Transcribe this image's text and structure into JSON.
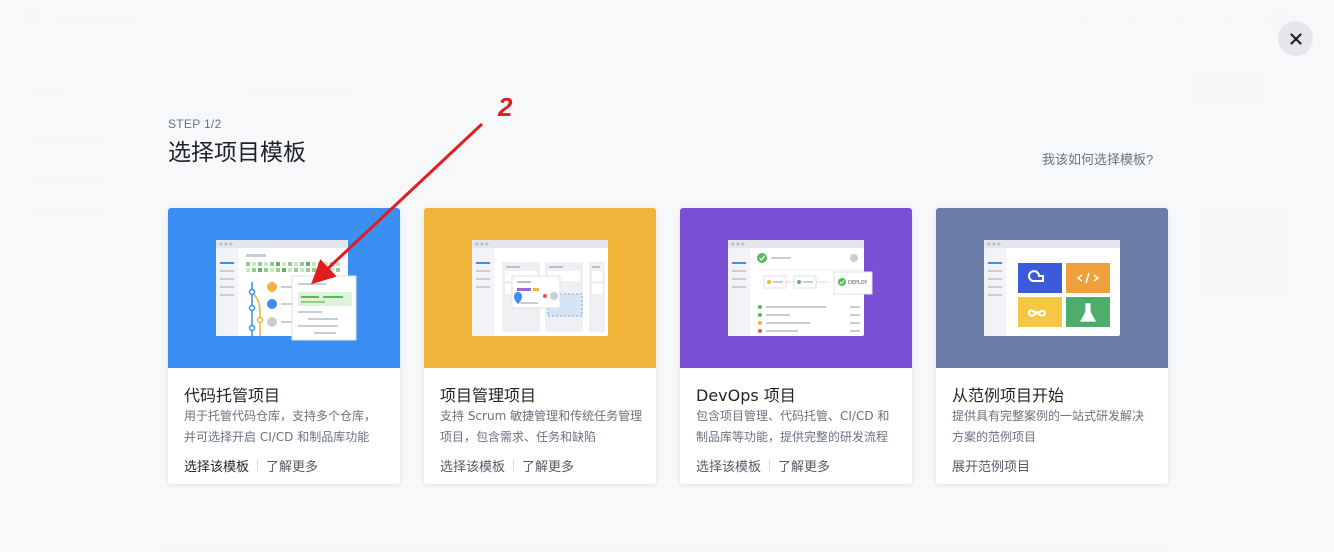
{
  "modal": {
    "step": "STEP 1/2",
    "title": "选择项目模板",
    "help_link": "我该如何选择模板?"
  },
  "cards": [
    {
      "name": "代码托管项目",
      "desc_line1": "用于托管代码仓库，支持多个仓库，",
      "desc_line2": "并可选择开启 CI/CD 和制品库功能",
      "action_primary": "选择该模板",
      "action_secondary": "了解更多",
      "hero_color": "#3b8ef2"
    },
    {
      "name": "项目管理项目",
      "desc_line1": "支持 Scrum 敏捷管理和传统任务管理",
      "desc_line2": "项目，包含需求、任务和缺陷",
      "action_primary": "选择该模板",
      "action_secondary": "了解更多",
      "hero_color": "#f0b43a"
    },
    {
      "name": "DevOps 项目",
      "desc_line1": "包含项目管理、代码托管、CI/CD 和",
      "desc_line2": "制品库等功能，提供完整的研发流程",
      "action_primary": "选择该模板",
      "action_secondary": "了解更多",
      "hero_color": "#7b4fd3",
      "hero_badge": "DEPLOY"
    },
    {
      "name": "从范例项目开始",
      "desc_line1": "提供具有完整案例的一站式研发解决",
      "desc_line2": "方案的范例项目",
      "action_primary": "展开范例项目",
      "hero_color": "#6b7da6"
    }
  ],
  "annotation": {
    "step_number": "2",
    "color": "#e11d1d"
  },
  "icons": {
    "close": "close-icon",
    "arrow": "arrow-annotation"
  }
}
